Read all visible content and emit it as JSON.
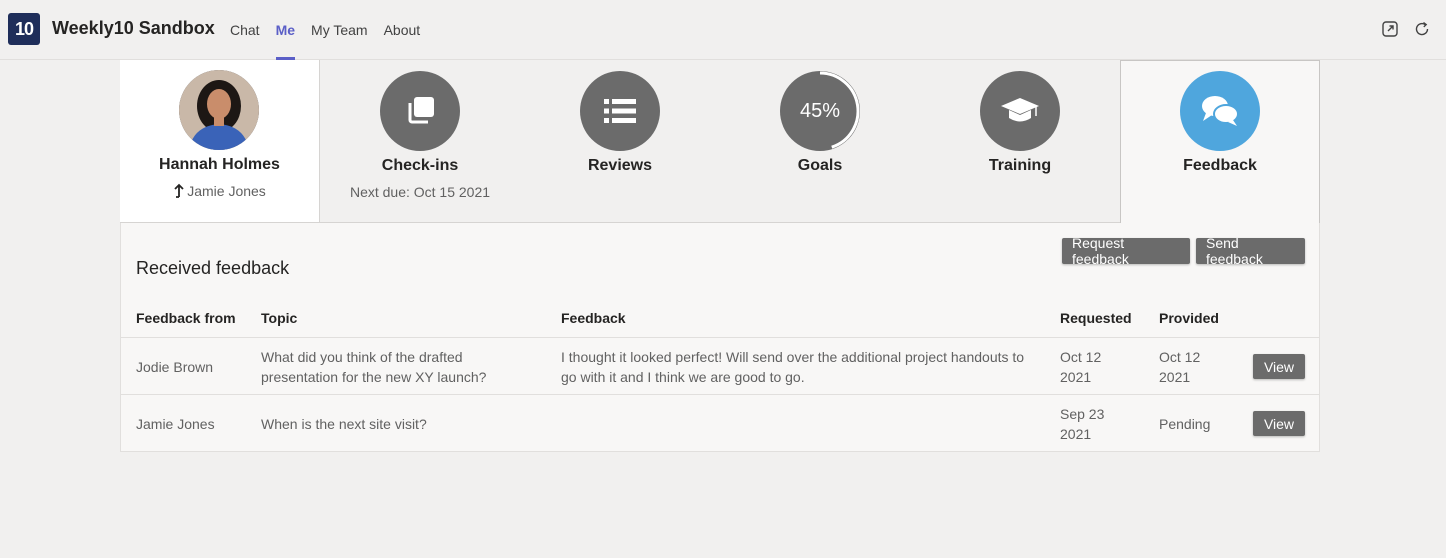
{
  "app": {
    "logo_text": "10",
    "title": "Weekly10 Sandbox"
  },
  "nav": [
    {
      "label": "Chat",
      "active": false
    },
    {
      "label": "Me",
      "active": true
    },
    {
      "label": "My Team",
      "active": false
    },
    {
      "label": "About",
      "active": false
    }
  ],
  "top_icons": [
    "popout-icon",
    "refresh-icon"
  ],
  "profile": {
    "name": "Hannah Holmes",
    "manager_icon": "arrow-up-icon",
    "manager": "Jamie Jones"
  },
  "tiles": [
    {
      "label": "Check-ins",
      "sub": "Next due: Oct 15 2021",
      "icon": "copy-icon"
    },
    {
      "label": "Reviews",
      "sub": "",
      "icon": "list-icon"
    },
    {
      "label": "Goals",
      "sub": "",
      "icon": "progress-ring",
      "progress_text": "45%",
      "progress": 0.45
    },
    {
      "label": "Training",
      "sub": "",
      "icon": "graduation-cap-icon"
    },
    {
      "label": "Feedback",
      "sub": "",
      "icon": "chat-bubbles-icon",
      "selected": true
    }
  ],
  "feedback": {
    "title": "Received feedback",
    "request_label": "Request feedback",
    "send_label": "Send feedback",
    "columns": [
      "Feedback from",
      "Topic",
      "Feedback",
      "Requested",
      "Provided"
    ],
    "rows": [
      {
        "from": "Jodie Brown",
        "topic_lines": [
          "What did you think of the drafted",
          "presentation for the new XY launch?"
        ],
        "feedback_lines": [
          "I thought it looked perfect! Will send over the additional project handouts to",
          "go with it and I think we are good to go."
        ],
        "requested_lines": [
          "Oct 12",
          "2021"
        ],
        "provided_lines": [
          "Oct 12",
          "2021"
        ],
        "action": "View"
      },
      {
        "from": "Jamie Jones",
        "topic_lines": [
          "When is the next site visit?"
        ],
        "feedback_lines": [],
        "requested_lines": [
          "Sep 23",
          "2021"
        ],
        "provided_lines": [
          "Pending"
        ],
        "action": "View"
      }
    ]
  },
  "colors": {
    "accent": "#5b5fc7",
    "tile_gray": "#6b6b6b",
    "feedback_blue": "#4fa6dd",
    "logo_bg": "#1f2e5a"
  }
}
